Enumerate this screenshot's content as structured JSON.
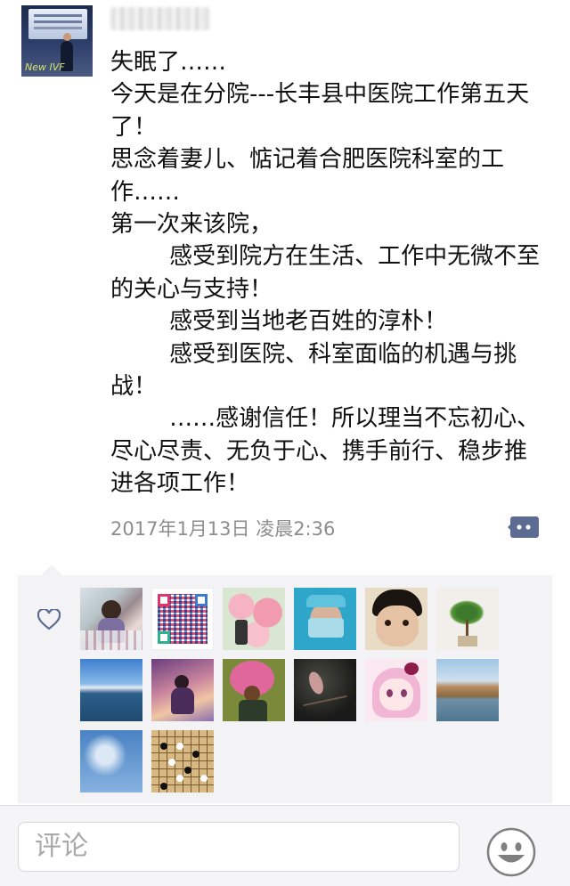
{
  "post": {
    "text": "失眠了……\n今天是在分院---长丰县中医院工作第五天了！\n思念着妻儿、惦记着合肥医院科室的工作……\n第一次来该院，\n        感受到院方在生活、工作中无微不至的关心与支持！\n        感受到当地老百姓的淳朴！\n        感受到医院、科室面临的机遇与挑战！\n        ……感谢信任！所以理当不忘初心、尽心尽责、无负于心、携手前行、稳步推进各项工作！",
    "timestamp": "2017年1月13日 凌晨2:36",
    "avatar_caption": "New IVF"
  },
  "colors": {
    "link_blue": "#5b6b92",
    "likes_bg": "#f3f3f5",
    "timestamp": "#8d8d8d"
  },
  "likers": [
    {
      "name": "liker-avatar-girl-flowers"
    },
    {
      "name": "liker-avatar-qr-code"
    },
    {
      "name": "liker-avatar-pink-flowers"
    },
    {
      "name": "liker-avatar-surgeon"
    },
    {
      "name": "liker-avatar-child"
    },
    {
      "name": "liker-avatar-plant"
    },
    {
      "name": "liker-avatar-lake"
    },
    {
      "name": "liker-avatar-girl-purple"
    },
    {
      "name": "liker-avatar-boy-fan"
    },
    {
      "name": "liker-avatar-bird"
    },
    {
      "name": "liker-avatar-cartoon-girl"
    },
    {
      "name": "liker-avatar-hills"
    },
    {
      "name": "liker-avatar-sky"
    },
    {
      "name": "liker-avatar-go-board"
    }
  ],
  "comment_bar": {
    "placeholder": "评论",
    "emoji_icon": "smiley-face-icon"
  },
  "icons": {
    "comment": "comment-bubble-icon",
    "like": "heart-icon"
  }
}
